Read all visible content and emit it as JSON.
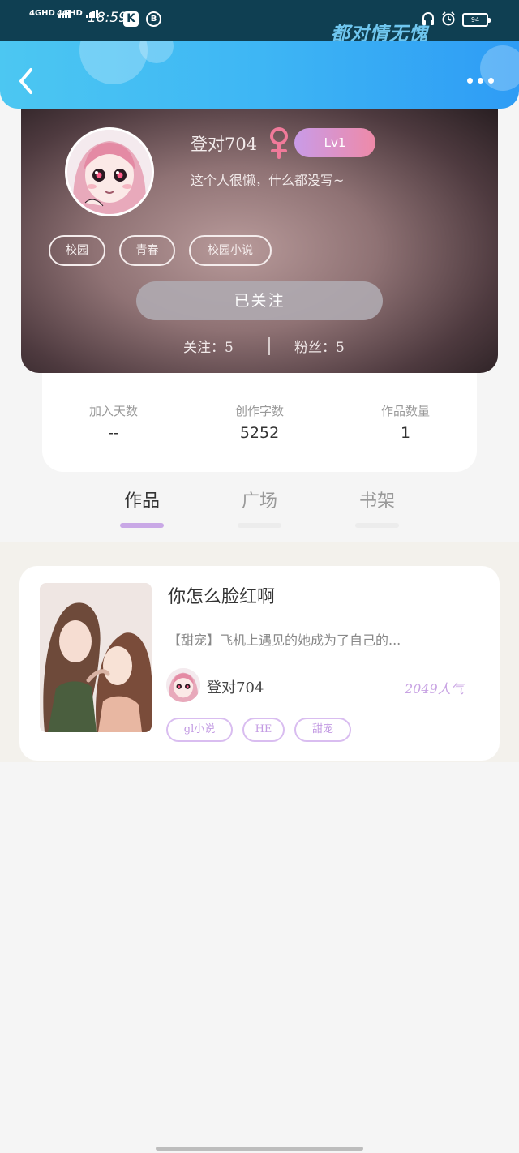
{
  "status_bar": {
    "sim1": "4GHD",
    "sim2": "4GHD",
    "time": "18:59",
    "app_icon_k": "K",
    "app_icon_b": "B",
    "watermark": "都对情无愧",
    "battery": "94"
  },
  "header": {
    "back_icon": "chevron-left-icon",
    "more_icon": "more-dots-icon"
  },
  "profile": {
    "username": "登对704",
    "gender_icon": "female-icon",
    "level": "Lv1",
    "bio": "这个人很懒，什么都没写~",
    "tags": [
      "校园",
      "青春",
      "校园小说"
    ],
    "follow_button": "已关注",
    "following_label": "关注：5",
    "followers_label": "粉丝：5"
  },
  "stats": [
    {
      "label": "加入天数",
      "value": "--"
    },
    {
      "label": "创作字数",
      "value": "5252"
    },
    {
      "label": "作品数量",
      "value": "1"
    }
  ],
  "tabs": [
    {
      "label": "作品",
      "active": true
    },
    {
      "label": "广场",
      "active": false
    },
    {
      "label": "书架",
      "active": false
    }
  ],
  "works": [
    {
      "title": "你怎么脸红啊",
      "description": "【甜宠】飞机上遇见的她成为了自己的...",
      "author": "登对704",
      "popularity": "2049人气",
      "tags": [
        "gl小说",
        "HE",
        "甜宠"
      ]
    }
  ],
  "colors": {
    "accent": "#3eb6f4",
    "tab_active_underline": "#c9a8e6",
    "tag_purple": "#c39be3"
  }
}
